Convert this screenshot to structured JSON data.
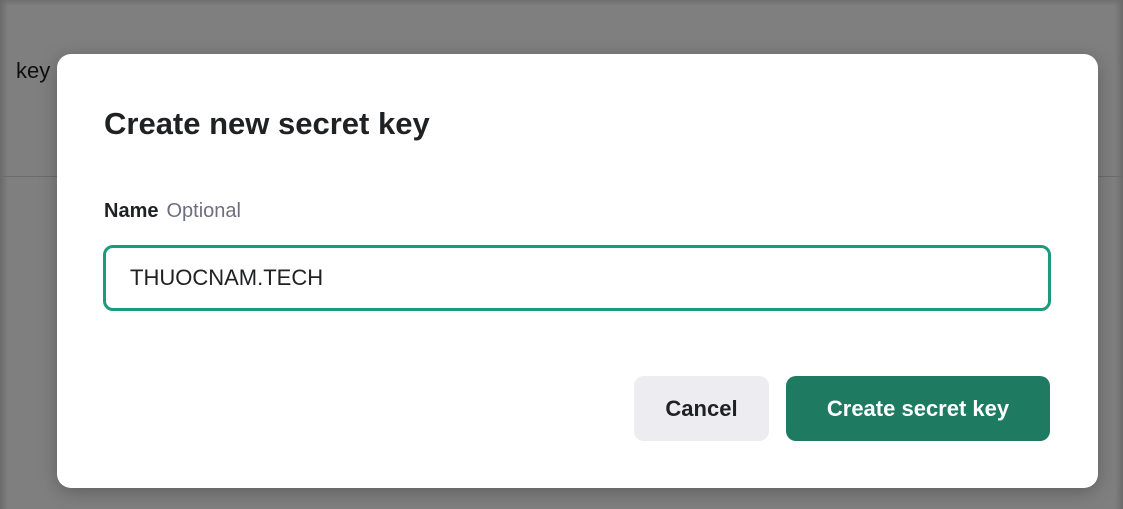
{
  "background": {
    "partial_text": "key"
  },
  "dialog": {
    "title": "Create new secret key",
    "name_field": {
      "label": "Name",
      "optional_hint": "Optional",
      "value": "THUOCNAM.TECH"
    },
    "buttons": {
      "cancel_label": "Cancel",
      "create_label": "Create secret key"
    }
  },
  "colors": {
    "accent": "#1e7b62",
    "input_focus_border": "#1a9b7c",
    "cancel_bg": "#ececf1",
    "overlay": "rgba(0,0,0,0.5)"
  }
}
